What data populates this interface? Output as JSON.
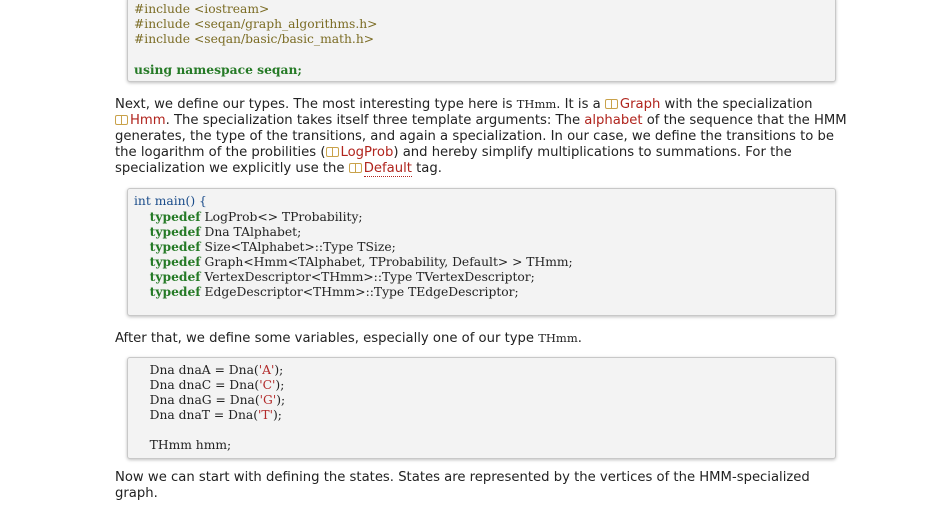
{
  "code1": {
    "lines": [
      "#include <iostream>",
      "#include <seqan/graph_algorithms.h>",
      "#include <seqan/basic/basic_math.h>",
      "",
      "using namespace seqan;"
    ]
  },
  "para1": {
    "t1": "Next, we define our types. The most interesting type here is ",
    "code_thmm": "THmm",
    "t2": ". It is a ",
    "link_graph": "Graph",
    "t3": " with the specialization",
    "link_hmm": "Hmm",
    "t4": ". The specialization takes itself three template arguments: The ",
    "link_alphabet": "alphabet",
    "t5": " of the sequence that the HMM generates, the type of the transitions, and again a specialization. In our case, we define the transitions to be the logarithm of the probilities (",
    "link_logprob": "LogProb",
    "t6": ") and hereby simplify multiplications to summations. For the specialization we explicitly use the ",
    "link_default": "Default",
    "t7": " tag."
  },
  "code2": {
    "l1": "int main() {",
    "typedef_kw": "typedef",
    "l2": " LogProb<> TProbability;",
    "l3": " Dna TAlphabet;",
    "l4": " Size<TAlphabet>::Type TSize;",
    "l5": " Graph<Hmm<TAlphabet, TProbability, Default> > THmm;",
    "l6": " VertexDescriptor<THmm>::Type TVertexDescriptor;",
    "l7": " EdgeDescriptor<THmm>::Type TEdgeDescriptor;"
  },
  "para2": {
    "t1": "After that, we define some variables, especially one of our type ",
    "code_thmm": "THmm",
    "t2": "."
  },
  "code3": {
    "a_pre": "Dna dnaA = Dna(",
    "a_str": "'A'",
    "c_pre": "Dna dnaC = Dna(",
    "c_str": "'C'",
    "g_pre": "Dna dnaG = Dna(",
    "g_str": "'G'",
    "t_pre": "Dna dnaT = Dna(",
    "t_str": "'T'",
    "end": ");",
    "hmm": "THmm hmm;"
  },
  "para3": {
    "text": "Now we can start with defining the states. States are represented by the vertices of the HMM-specialized graph."
  },
  "colors": {
    "link": "#b0241d",
    "keyword": "#257a26",
    "include": "#a26b0d",
    "string": "#b22a2a"
  }
}
